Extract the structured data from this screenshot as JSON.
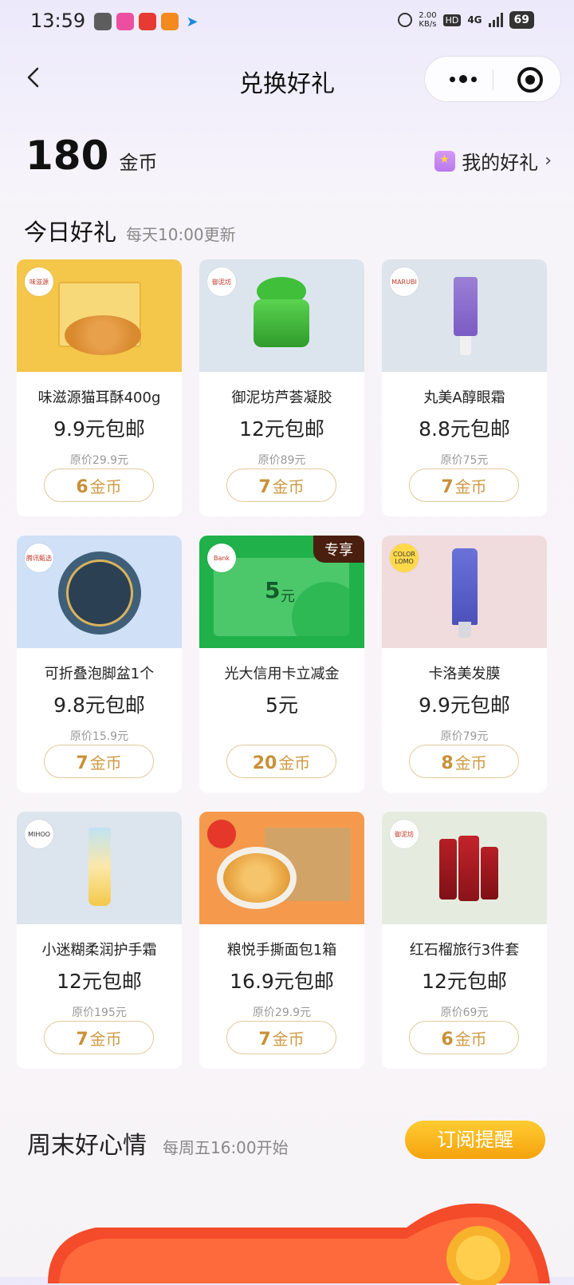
{
  "status_bar": {
    "time": "13:59",
    "net_speed_value": "2.00",
    "net_speed_unit": "KB/s",
    "hd": "HD",
    "network": "4G",
    "battery": "69",
    "apps": [
      {
        "name": "vpn-app",
        "color": "#5d5d5d"
      },
      {
        "name": "vivo-app",
        "color": "#ec4fa0"
      },
      {
        "name": "tmall-app",
        "color": "#e73a32"
      },
      {
        "name": "taobao-app",
        "color": "#f28a1e"
      },
      {
        "name": "send-app",
        "color": "#1b8be0"
      }
    ]
  },
  "nav": {
    "title": "兑换好礼"
  },
  "coins": {
    "amount": "180",
    "unit": "金币",
    "my_gifts": "我的好礼"
  },
  "today": {
    "title": "今日好礼",
    "subtitle": "每天10:00更新"
  },
  "coin_unit": "金币",
  "products": [
    {
      "name": "味滋源猫耳酥400g",
      "price": "9.9元包邮",
      "original": "原价29.9元",
      "coins": "6",
      "brand": "味滋源",
      "bg": "#f4c64a",
      "exclusive": ""
    },
    {
      "name": "御泥坊芦荟凝胶",
      "price": "12元包邮",
      "original": "原价89元",
      "coins": "7",
      "brand": "御泥坊",
      "bg": "#dce5ee",
      "exclusive": ""
    },
    {
      "name": "丸美A醇眼霜",
      "price": "8.8元包邮",
      "original": "原价75元",
      "coins": "7",
      "brand": "MARUBI",
      "bg": "#dde4ec",
      "exclusive": ""
    },
    {
      "name": "可折叠泡脚盆1个",
      "price": "9.8元包邮",
      "original": "原价15.9元",
      "coins": "7",
      "brand": "腾讯甄选",
      "bg": "#cfe0f7",
      "exclusive": ""
    },
    {
      "name": "光大信用卡立减金",
      "price": "5元",
      "original": "",
      "coins": "20",
      "brand": "Bank",
      "bg": "#20b14a",
      "exclusive": "专享",
      "voucher_amount": "5",
      "voucher_unit": "元"
    },
    {
      "name": "卡洛美发膜",
      "price": "9.9元包邮",
      "original": "原价79元",
      "coins": "8",
      "brand": "COLOR LOMO",
      "bg": "#f0dcdc",
      "exclusive": ""
    },
    {
      "name": "小迷糊柔润护手霜",
      "price": "12元包邮",
      "original": "原价195元",
      "coins": "7",
      "brand": "MIHOO",
      "bg": "#dce4ee",
      "exclusive": ""
    },
    {
      "name": "粮悦手撕面包1箱",
      "price": "16.9元包邮",
      "original": "原价29.9元",
      "coins": "7",
      "brand": "",
      "bg": "#f59a4c",
      "exclusive": ""
    },
    {
      "name": "红石榴旅行3件套",
      "price": "12元包邮",
      "original": "原价69元",
      "coins": "6",
      "brand": "御泥坊",
      "bg": "#e5ecdf",
      "exclusive": ""
    }
  ],
  "weekend": {
    "title": "周末好心情",
    "subtitle": "每周五16:00开始",
    "subscribe": "订阅提醒"
  }
}
